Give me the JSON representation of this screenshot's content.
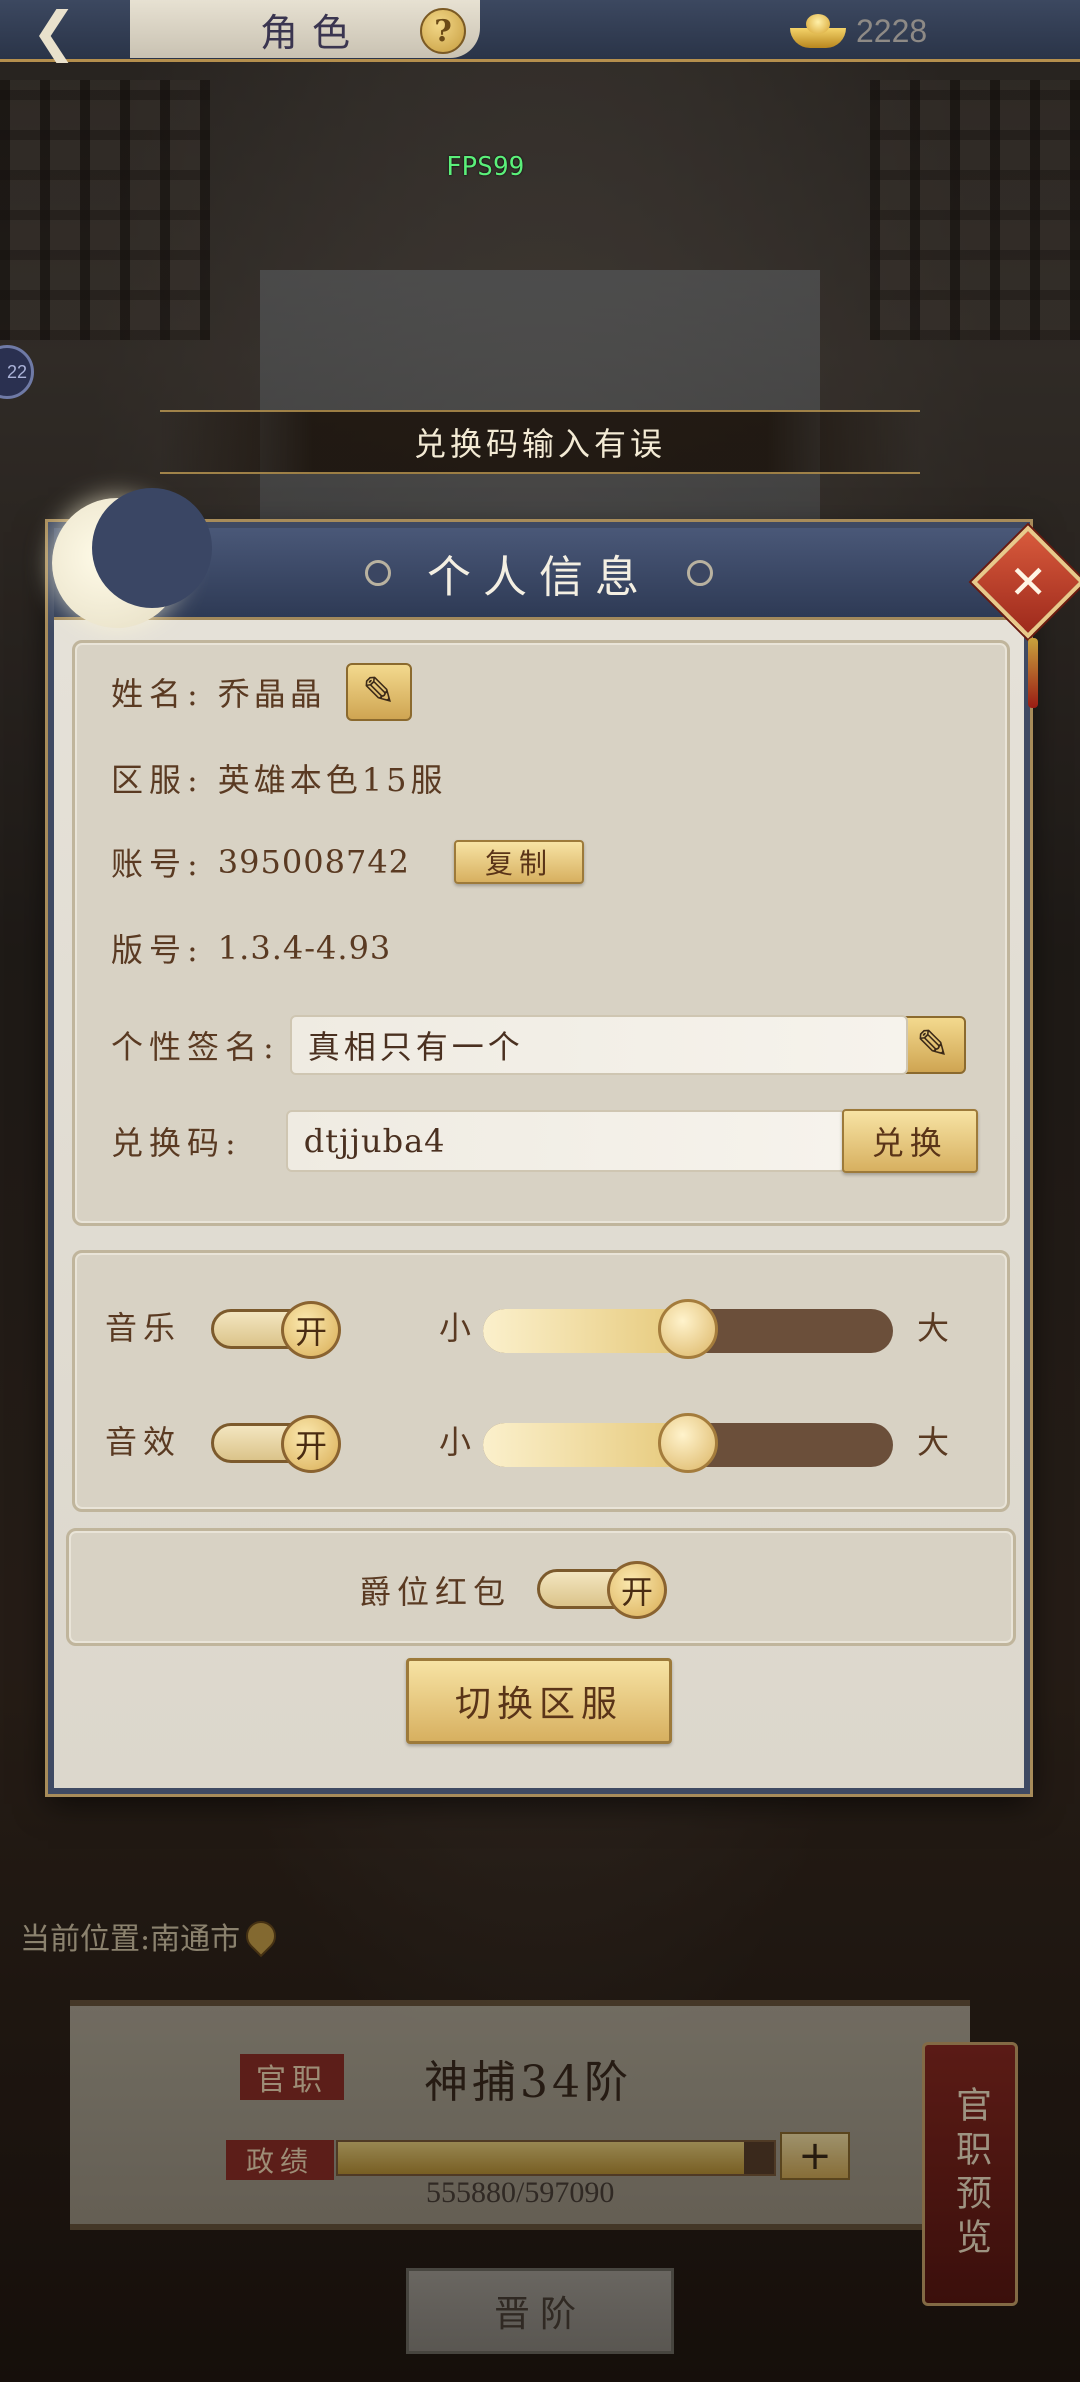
{
  "topbar": {
    "title": "角色",
    "help_icon": "?",
    "currency_icon": "gold-ingot-icon",
    "currency_value": "2228"
  },
  "fps": "FPS99",
  "side_badge": "22",
  "toast": "兑换码输入有误",
  "dialog": {
    "title": "个人信息",
    "name_label": "姓名:",
    "name_value": "乔晶晶",
    "server_label": "区服:",
    "server_value": "英雄本色15服",
    "account_label": "账号:",
    "account_value": "395008742",
    "copy_button": "复制",
    "version_label": "版号:",
    "version_value": "1.3.4-4.93",
    "signature_label": "个性签名:",
    "signature_value": "真相只有一个",
    "code_label": "兑换码:",
    "code_value": "dtjjuba4",
    "redeem_button": "兑换",
    "music_label": "音乐",
    "music_toggle": "开",
    "music_volume": 0.5,
    "sfx_label": "音效",
    "sfx_toggle": "开",
    "sfx_volume": 0.5,
    "slider_min": "小",
    "slider_max": "大",
    "red_packet_label": "爵位红包",
    "red_packet_toggle": "开",
    "switch_server_button": "切换区服"
  },
  "behind": {
    "location": "当前位置:南通市",
    "rank_tag": "官职",
    "rank_title": "神捕34阶",
    "merit_tag": "政绩",
    "merit_value": "555880/597090",
    "merit_progress": 0.931,
    "preview_button": "官职预览",
    "advance_button": "晋阶"
  },
  "colors": {
    "accent_gold": "#d7b060",
    "header_blue": "#3a4664",
    "close_red": "#b8372a"
  }
}
